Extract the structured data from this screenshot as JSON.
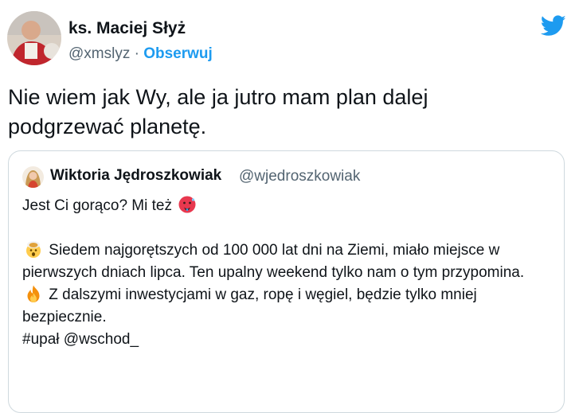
{
  "tweet": {
    "author_name": "ks. Maciej Słyż",
    "author_handle": "@xmslyz",
    "separator": "·",
    "follow_label": "Obserwuj",
    "text": "Nie wiem jak Wy, ale ja jutro mam plan dalej podgrzewać planetę."
  },
  "quote": {
    "author_name": "Wiktoria Jędroszkowiak",
    "author_handle": "@wjedroszkowiak",
    "line1": "Jest Ci gorąco? Mi też",
    "para1": "Siedem najgorętszych od 100 000 lat dni na Ziemi, miało miejsce w pierwszych dniach lipca. Ten upalny weekend tylko nam o tym przypomina.",
    "para2": "Z dalszymi inwestycjami w gaz, ropę i węgiel, będzie tylko mniej bezpiecznie.",
    "hashtag": "#upał",
    "mention": "@wschod_"
  },
  "icons": {
    "platform": "twitter-bird-icon",
    "hot_face": "hot-face-emoji",
    "exploding_head": "exploding-head-emoji",
    "fire": "fire-emoji"
  },
  "colors": {
    "accent": "#1d9bf0",
    "secondary_text": "#536471",
    "border": "#cfd9de"
  }
}
